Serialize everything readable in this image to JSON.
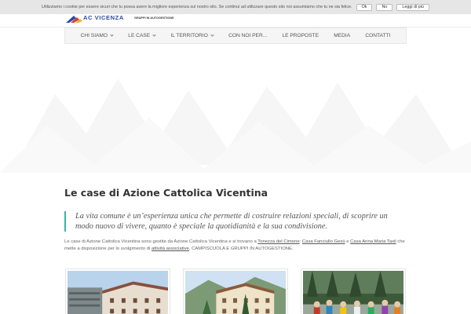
{
  "cookie": {
    "text": "Utilizziamo i cookie per essere sicuri che tu possa avere la migliore esperienza sul nostro sito. Se continui ad utilizzare questo sito noi assumiamo che tu ne sia felice.",
    "ok_label": "Ok",
    "no_label": "No",
    "more_label": "Leggi di più"
  },
  "header": {
    "logo_title": "AC VICENZA",
    "logo_subtitle": "GRUPPI IN AUTOGESTIONE"
  },
  "nav": {
    "items": [
      {
        "label": "CHI SIAMO"
      },
      {
        "label": "LE CASE"
      },
      {
        "label": "IL TERRITORIO"
      },
      {
        "label": "CON NOI PER..."
      },
      {
        "label": "LE PROPOSTE"
      },
      {
        "label": "MEDIA"
      },
      {
        "label": "CONTATTI"
      }
    ]
  },
  "content": {
    "title": "Le case di Azione Cattolica Vicentina",
    "quote": "La vita comune è un’esperienza unica che permette di costruire relazioni speciali, di scoprire un modo nuovo di vivere, quanto è speciale la quotidianità e la sua condivisione.",
    "body_1": "Le case di Azione Cattolica Vicentina sono gestite da Azione Cattolica Vicentina e si trovano a ",
    "link_1": "Tonezza del Cimone",
    "body_2": ": ",
    "link_2": "Casa Fanciullo Gesù",
    "body_3": " e ",
    "link_3": "Casa Anna Maria Taxil",
    "body_4": " che mette a disposizione per lo svolgimento di ",
    "link_4": "attività associative",
    "body_5": ", CAMPISCUOLA E GRUPPI IN AUTOGESTIONE."
  },
  "colors": {
    "accent": "#37b5a8",
    "logo_blue": "#2a4da0",
    "nav_bg": "#f5f5f5"
  }
}
